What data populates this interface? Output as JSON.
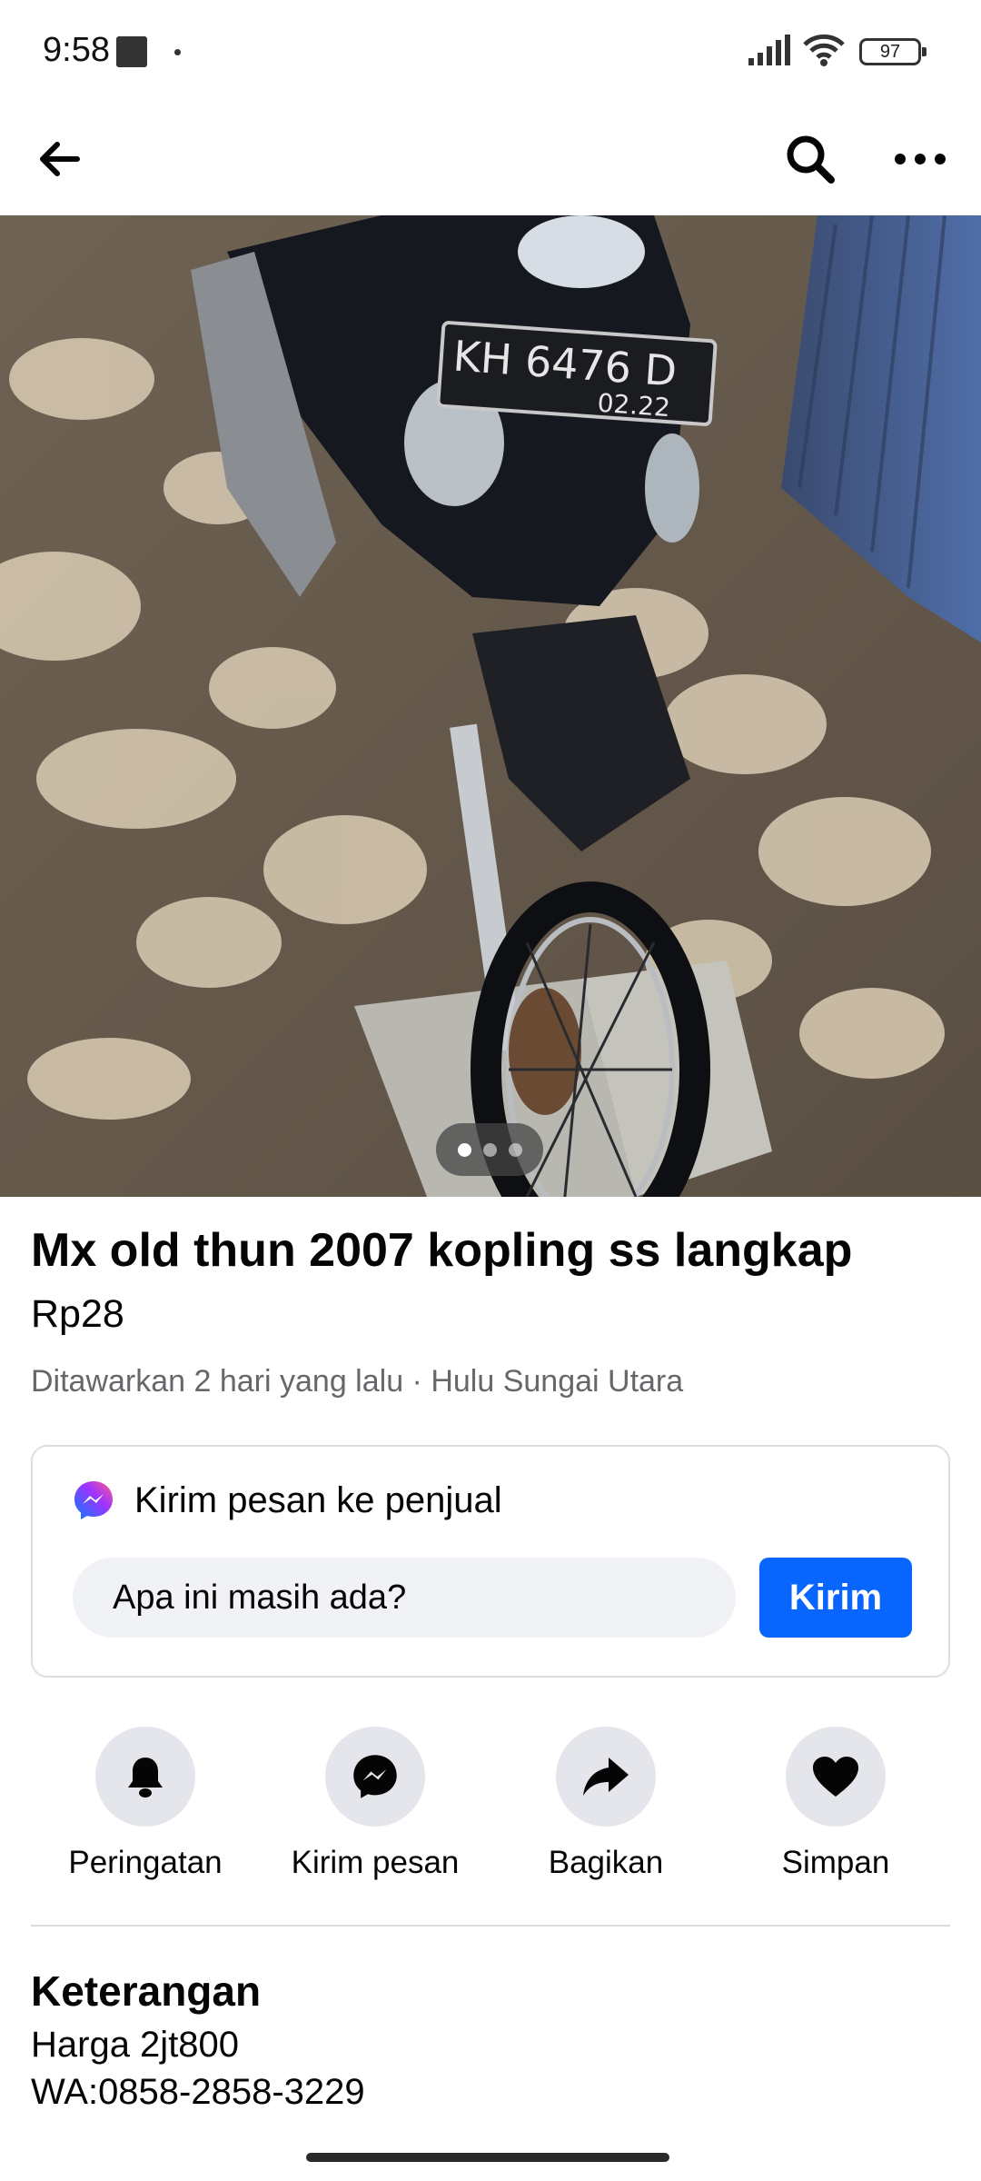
{
  "status_bar": {
    "time": "9:58",
    "battery": "97",
    "icons": [
      "notification-square-icon",
      "dot-icon",
      "signal-icon",
      "wifi-icon",
      "battery-icon"
    ]
  },
  "top_bar": {
    "icons": [
      "back-arrow-icon",
      "search-icon",
      "more-options-icon"
    ]
  },
  "photo": {
    "plate_top": "KH 6476 D",
    "plate_bottom": "02.22",
    "pager": {
      "total": 3,
      "active": 1
    }
  },
  "listing": {
    "title": "Mx old thun 2007 kopling ss langkap",
    "price": "Rp28",
    "meta": "Ditawarkan 2 hari yang lalu · Hulu Sungai Utara"
  },
  "message_card": {
    "heading": "Kirim pesan ke penjual",
    "input_value": "Apa ini masih ada?",
    "send_label": "Kirim"
  },
  "actions": [
    {
      "label": "Peringatan",
      "icon": "bell-icon"
    },
    {
      "label": "Kirim pesan",
      "icon": "messenger-icon"
    },
    {
      "label": "Bagikan",
      "icon": "share-icon"
    },
    {
      "label": "Simpan",
      "icon": "heart-icon"
    }
  ],
  "description": {
    "heading": "Keterangan",
    "lines": [
      "Harga 2jt800",
      "WA:0858-2858-3229"
    ]
  },
  "colors": {
    "accent": "#0866ff",
    "secondary_text": "#65676b",
    "action_circle": "#e4e6eb",
    "input_bg": "#f0f2f5"
  }
}
